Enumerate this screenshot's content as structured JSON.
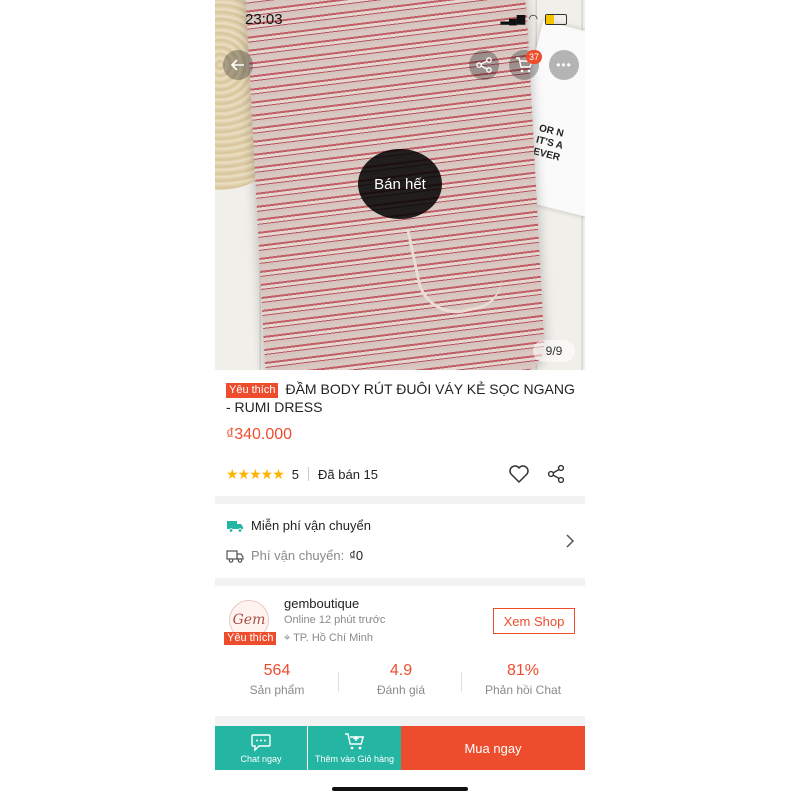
{
  "status_bar": {
    "time": "23:03"
  },
  "gallery": {
    "cart_count": "37",
    "sold_out_label": "Bán hết",
    "pager": "9/9",
    "card_print": "OR N\nIT'S A\nEVER"
  },
  "product": {
    "favorite_badge": "Yêu thích",
    "title": "ĐẦM BODY RÚT ĐUÔI VÁY KẺ SỌC NGANG - RUMI DRESS",
    "price": "₫340.000",
    "rating_stars": "★★★★★",
    "rating_value": "5",
    "sold": "Đã bán 15"
  },
  "shipping": {
    "free_label": "Miễn phí vận chuyển",
    "fee_label": "Phí vận chuyển:",
    "fee_value": "₫0"
  },
  "shop": {
    "logo_text": "Gem",
    "favorite_badge": "Yêu thích",
    "name": "gemboutique",
    "online": "Online 12 phút trước",
    "location": "TP. Hồ Chí Minh",
    "view_shop_label": "Xem Shop",
    "stats": [
      {
        "value": "564",
        "label": "Sản phẩm"
      },
      {
        "value": "4.9",
        "label": "Đánh giá"
      },
      {
        "value": "81%",
        "label": "Phản hồi Chat"
      }
    ]
  },
  "bottom_bar": {
    "chat_label": "Chat ngay",
    "add_cart_label": "Thêm vào Giỏ hàng",
    "buy_label": "Mua ngay"
  },
  "colors": {
    "accent": "#ee4d2d",
    "teal": "#24b5a3",
    "star": "#ffb301"
  }
}
